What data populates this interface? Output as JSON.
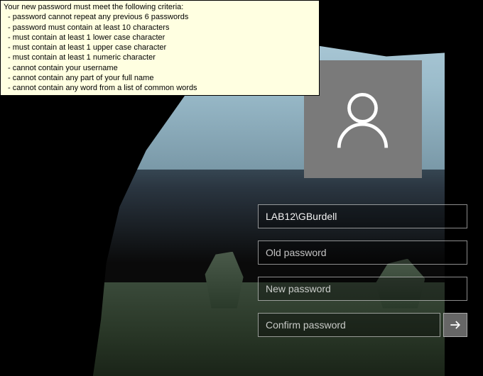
{
  "tooltip": {
    "heading": "Your new password must meet the following criteria:",
    "rules": [
      "- password cannot repeat any previous 6 passwords",
      "- password must contain at least 10 characters",
      "- must contain at least 1 lower case character",
      "- must contain at least 1 upper case character",
      "- must contain at least 1 numeric character",
      "- cannot contain your username",
      "- cannot contain any part of your full name",
      "- cannot contain any word from a list of common words"
    ]
  },
  "login": {
    "username": "LAB12\\GBurdell",
    "old_password_placeholder": "Old password",
    "new_password_placeholder": "New password",
    "confirm_password_placeholder": "Confirm password"
  }
}
